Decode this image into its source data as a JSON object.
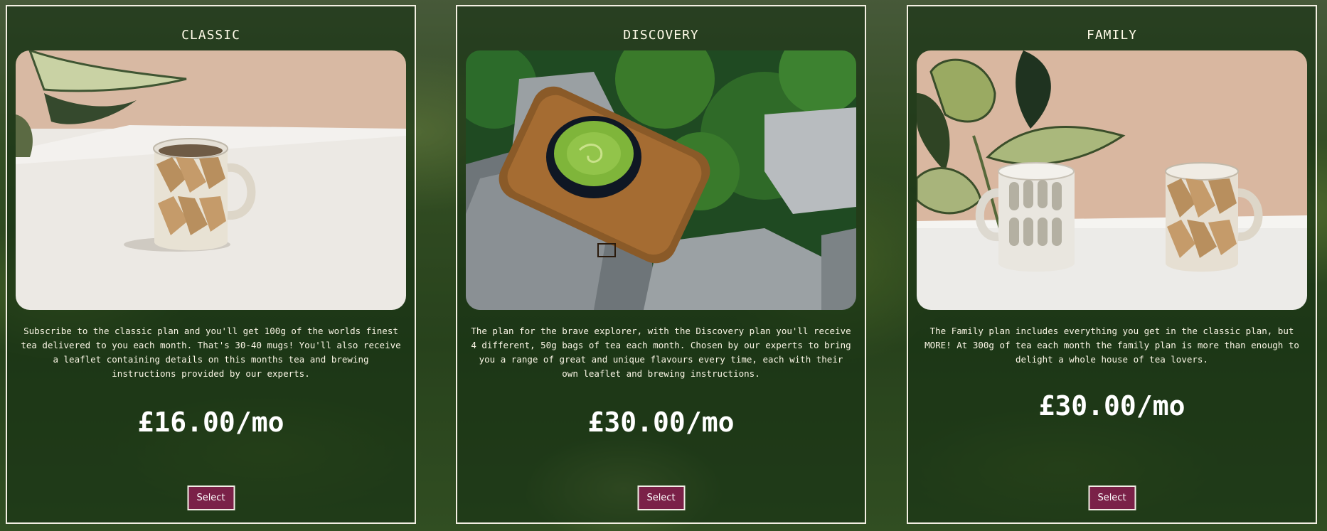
{
  "plans": [
    {
      "title": "CLASSIC",
      "image": "single-striped-mug-photo",
      "description": "Subscribe to the classic plan and you'll get 100g of the worlds finest tea delivered to you each month. That's 30-40 mugs! You'll also receive a leaflet containing details on this months tea and brewing instructions provided by our experts.",
      "price": "£16.00/mo",
      "button_label": "Select"
    },
    {
      "title": "DISCOVERY",
      "image": "matcha-bowl-on-rocks-photo",
      "description": "The plan for the brave explorer, with the Discovery plan you'll receive 4 different, 50g bags of tea each month. Chosen by our experts to bring you a range of great and unique flavours every time, each with their own leaflet and brewing instructions.",
      "price": "£30.00/mo",
      "button_label": "Select"
    },
    {
      "title": "FAMILY",
      "image": "two-mugs-photo",
      "description": "The Family plan includes everything you get in the classic plan, but MORE! At 300g of tea each month the family plan is more than enough to delight a whole house of tea lovers.",
      "price": "£30.00/mo",
      "button_label": "Select"
    }
  ],
  "colors": {
    "button_bg": "#7a2148",
    "card_border": "#f3efe2",
    "text": "#fff8e6"
  }
}
